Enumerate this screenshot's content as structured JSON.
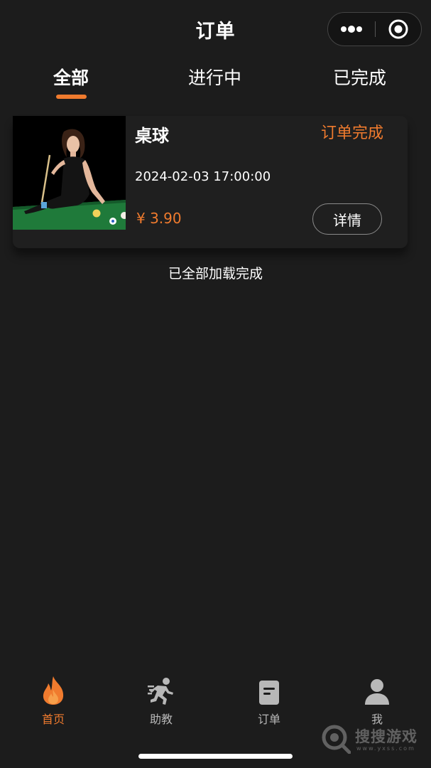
{
  "header": {
    "title": "订单"
  },
  "tabs": [
    {
      "label": "全部",
      "active": true
    },
    {
      "label": "进行中",
      "active": false
    },
    {
      "label": "已完成",
      "active": false
    }
  ],
  "orders": [
    {
      "title": "桌球",
      "status": "订单完成",
      "time": "2024-02-03 17:00:00",
      "price": "¥ 3.90",
      "detail_label": "详情"
    }
  ],
  "list_footer": "已全部加载完成",
  "tabbar": [
    {
      "label": "首页",
      "icon": "flame-icon",
      "active": true
    },
    {
      "label": "助教",
      "icon": "running-person-icon",
      "active": false
    },
    {
      "label": "订单",
      "icon": "document-icon",
      "active": false
    },
    {
      "label": "我",
      "icon": "user-icon",
      "active": false
    }
  ],
  "watermark": {
    "text": "搜搜游戏",
    "sub": "www.yxss.com"
  },
  "colors": {
    "accent": "#f07b2e",
    "background": "#1c1c1c"
  }
}
